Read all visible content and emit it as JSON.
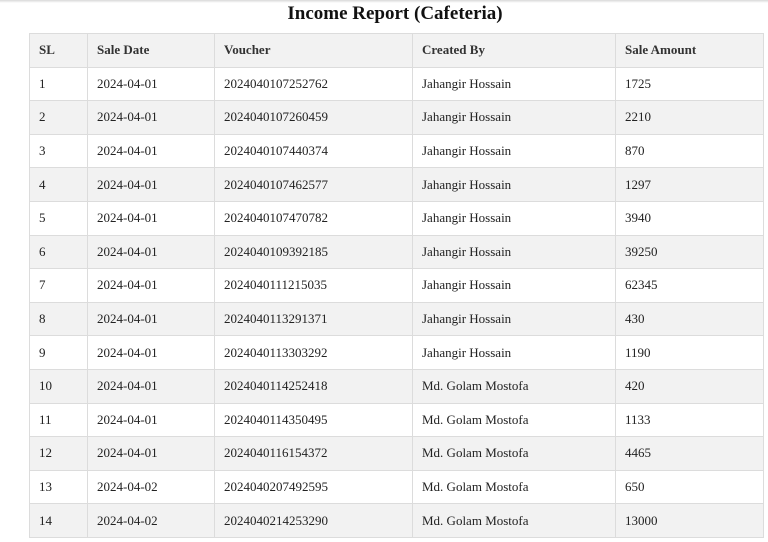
{
  "report": {
    "title": "Income Report (Cafeteria)"
  },
  "table": {
    "headers": [
      "SL",
      "Sale Date",
      "Voucher",
      "Created By",
      "Sale Amount"
    ],
    "rows": [
      [
        "1",
        "2024-04-01",
        "2024040107252762",
        "Jahangir Hossain",
        "1725"
      ],
      [
        "2",
        "2024-04-01",
        "2024040107260459",
        "Jahangir Hossain",
        "2210"
      ],
      [
        "3",
        "2024-04-01",
        "2024040107440374",
        "Jahangir Hossain",
        "870"
      ],
      [
        "4",
        "2024-04-01",
        "2024040107462577",
        "Jahangir Hossain",
        "1297"
      ],
      [
        "5",
        "2024-04-01",
        "2024040107470782",
        "Jahangir Hossain",
        "3940"
      ],
      [
        "6",
        "2024-04-01",
        "2024040109392185",
        "Jahangir Hossain",
        "39250"
      ],
      [
        "7",
        "2024-04-01",
        "2024040111215035",
        "Jahangir Hossain",
        "62345"
      ],
      [
        "8",
        "2024-04-01",
        "2024040113291371",
        "Jahangir Hossain",
        "430"
      ],
      [
        "9",
        "2024-04-01",
        "2024040113303292",
        "Jahangir Hossain",
        "1190"
      ],
      [
        "10",
        "2024-04-01",
        "2024040114252418",
        "Md. Golam Mostofa",
        "420"
      ],
      [
        "11",
        "2024-04-01",
        "2024040114350495",
        "Md. Golam Mostofa",
        "1133"
      ],
      [
        "12",
        "2024-04-01",
        "2024040116154372",
        "Md. Golam Mostofa",
        "4465"
      ],
      [
        "13",
        "2024-04-02",
        "2024040207492595",
        "Md. Golam Mostofa",
        "650"
      ],
      [
        "14",
        "2024-04-02",
        "2024040214253290",
        "Md. Golam Mostofa",
        "13000"
      ]
    ]
  }
}
